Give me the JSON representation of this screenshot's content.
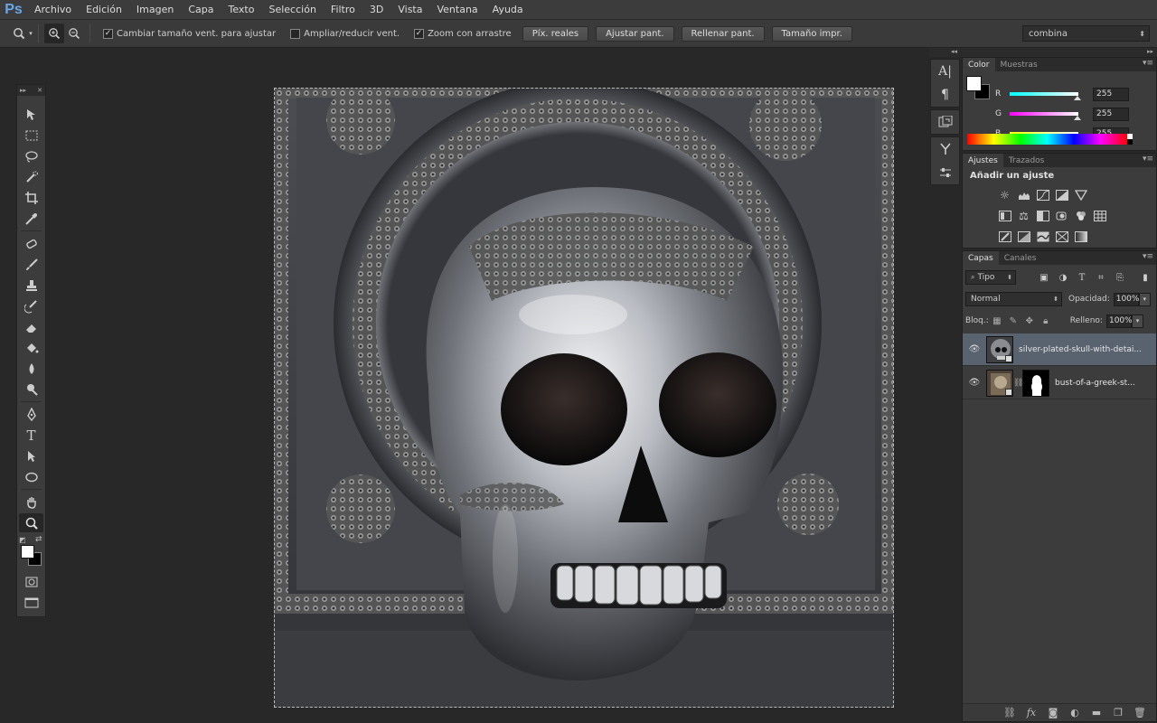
{
  "app": {
    "logo": "Ps",
    "menu": [
      "Archivo",
      "Edición",
      "Imagen",
      "Capa",
      "Texto",
      "Selección",
      "Filtro",
      "3D",
      "Vista",
      "Ventana",
      "Ayuda"
    ]
  },
  "options_bar": {
    "checks": [
      {
        "label": "Cambiar tamaño vent. para ajustar",
        "checked": true
      },
      {
        "label": "Ampliar/reducir vent.",
        "checked": false
      },
      {
        "label": "Zoom con arrastre",
        "checked": true
      }
    ],
    "buttons": [
      "Píx. reales",
      "Ajustar pant.",
      "Rellenar pant.",
      "Tamaño impr."
    ],
    "workspace": "combina"
  },
  "color_panel": {
    "tabs": [
      "Color",
      "Muestras"
    ],
    "r_label": "R",
    "g_label": "G",
    "b_label": "B",
    "r": "255",
    "g": "255",
    "b": "255",
    "foreground": "#ffffff",
    "background": "#000000"
  },
  "adjustments_panel": {
    "tabs": [
      "Ajustes",
      "Trazados"
    ],
    "title": "Añadir un ajuste"
  },
  "layers_panel": {
    "tabs": [
      "Capas",
      "Canales"
    ],
    "filter": "Tipo",
    "blend_mode": "Normal",
    "opacity_label": "Opacidad:",
    "opacity": "100%",
    "lock_label": "Bloq.:",
    "fill_label": "Relleno:",
    "fill": "100%",
    "layers": [
      {
        "name": "silver-plated-skull-with-detai...",
        "selected": true
      },
      {
        "name": "bust-of-a-greek-st...",
        "selected": false
      }
    ]
  }
}
